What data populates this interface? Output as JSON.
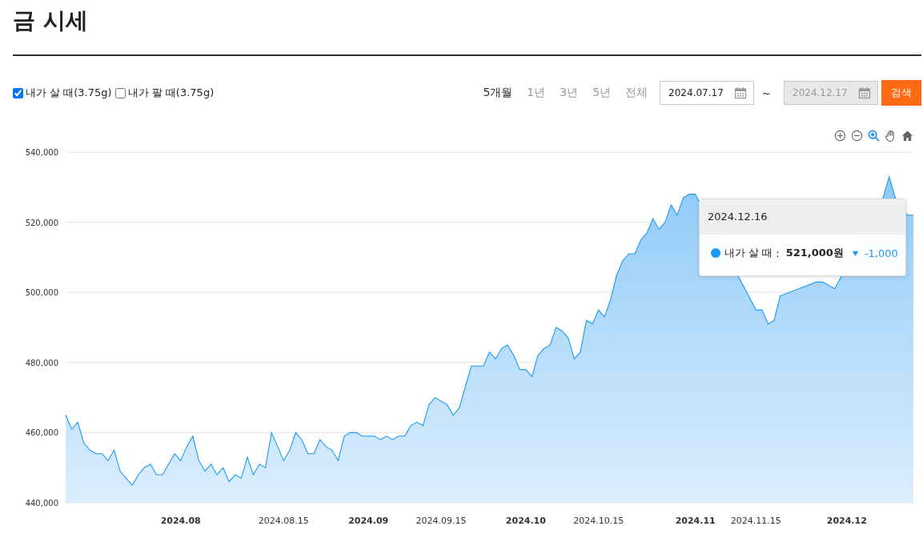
{
  "title": "금 시세",
  "legend": [
    {
      "label": "내가 살 때(3.75g)",
      "checked": true
    },
    {
      "label": "내가 팔 때(3.75g)",
      "checked": false
    }
  ],
  "periods": [
    {
      "label": "5개월",
      "selected": true
    },
    {
      "label": "1년",
      "selected": false
    },
    {
      "label": "3년",
      "selected": false
    },
    {
      "label": "5년",
      "selected": false
    },
    {
      "label": "전체",
      "selected": false
    }
  ],
  "date_range": {
    "start": {
      "value": "2024.07.17",
      "disabled": false
    },
    "separator": "~",
    "end": {
      "value": "2024.12.17",
      "disabled": true
    }
  },
  "search_button": "검색",
  "toolbar": [
    {
      "kind": "zoom-in",
      "selected": false
    },
    {
      "kind": "zoom-out",
      "selected": false
    },
    {
      "kind": "magnifier",
      "selected": true
    },
    {
      "kind": "pan",
      "selected": false
    },
    {
      "kind": "home",
      "selected": false
    }
  ],
  "chart": {
    "chart_data": {
      "type": "area",
      "grid": true,
      "ylim": [
        440000,
        540000
      ],
      "categories": [
        null,
        null,
        null,
        null,
        null,
        null,
        null,
        null,
        null,
        null,
        null,
        null,
        null,
        null,
        null,
        null,
        null,
        null,
        null,
        "2024.08",
        null,
        null,
        null,
        null,
        null,
        null,
        null,
        null,
        null,
        null,
        null,
        null,
        null,
        null,
        null,
        null,
        "2024.08.15",
        null,
        null,
        null,
        null,
        null,
        null,
        null,
        null,
        null,
        null,
        null,
        null,
        null,
        "2024.09",
        null,
        null,
        null,
        null,
        null,
        null,
        null,
        null,
        null,
        null,
        null,
        "2024.09.15",
        null,
        null,
        null,
        null,
        null,
        null,
        null,
        null,
        null,
        null,
        null,
        null,
        null,
        "2024.10",
        null,
        null,
        null,
        null,
        null,
        null,
        null,
        null,
        null,
        null,
        null,
        "2024.10.15",
        null,
        null,
        null,
        null,
        null,
        null,
        null,
        null,
        null,
        null,
        null,
        null,
        null,
        null,
        null,
        "2024.11",
        null,
        null,
        null,
        null,
        null,
        null,
        null,
        null,
        null,
        "2024.11.15",
        null,
        null,
        null,
        null,
        null,
        null,
        null,
        null,
        null,
        null,
        null,
        null,
        null,
        null,
        "2024.12",
        null,
        null,
        null,
        null,
        null,
        null,
        null,
        null,
        null,
        null,
        null
      ],
      "yticks": [
        {
          "value": 440000,
          "label": "440,000"
        },
        {
          "value": 460000,
          "label": "460,000"
        },
        {
          "value": 480000,
          "label": "480,000"
        },
        {
          "value": 500000,
          "label": "500,000"
        },
        {
          "value": 520000,
          "label": "520,000"
        },
        {
          "value": 540000,
          "label": "540,000"
        }
      ],
      "series": [
        {
          "name": "내가 살 때",
          "color": "#1a9af5",
          "values": [
            465000,
            461000,
            463000,
            457000,
            455000,
            454000,
            454000,
            452000,
            455000,
            449000,
            447000,
            445000,
            448000,
            450000,
            451000,
            448000,
            448000,
            451000,
            454000,
            452000,
            456000,
            459000,
            452000,
            449000,
            451000,
            448000,
            450000,
            446000,
            448000,
            447000,
            453000,
            448000,
            451000,
            450000,
            460000,
            456000,
            452000,
            455000,
            460000,
            458000,
            454000,
            454000,
            458000,
            456000,
            455000,
            452000,
            459000,
            460000,
            460000,
            459000,
            459000,
            459000,
            458000,
            459000,
            458000,
            459000,
            459000,
            462000,
            463000,
            462000,
            468000,
            470000,
            469000,
            468000,
            465000,
            467000,
            473000,
            479000,
            479000,
            479000,
            483000,
            481000,
            484000,
            485000,
            482000,
            478000,
            478000,
            476000,
            482000,
            484000,
            485000,
            490000,
            489000,
            487000,
            481000,
            483000,
            492000,
            491000,
            495000,
            493000,
            498000,
            505000,
            509000,
            511000,
            511000,
            515000,
            517000,
            521000,
            518000,
            520000,
            525000,
            522000,
            527000,
            528000,
            528000,
            null,
            null,
            null,
            null,
            null,
            null,
            null,
            null,
            null,
            495000,
            495000,
            491000,
            492000,
            499000,
            null,
            null,
            null,
            null,
            null,
            503000,
            503000,
            null,
            501000,
            null,
            null,
            null,
            null,
            null,
            null,
            null,
            527000,
            533000,
            527000,
            null,
            522000,
            522000
          ]
        }
      ]
    },
    "tooltip": {
      "date": "2024.12.16",
      "separator": ":",
      "value": "521,000원",
      "falling": true,
      "change": "-1,000"
    }
  }
}
